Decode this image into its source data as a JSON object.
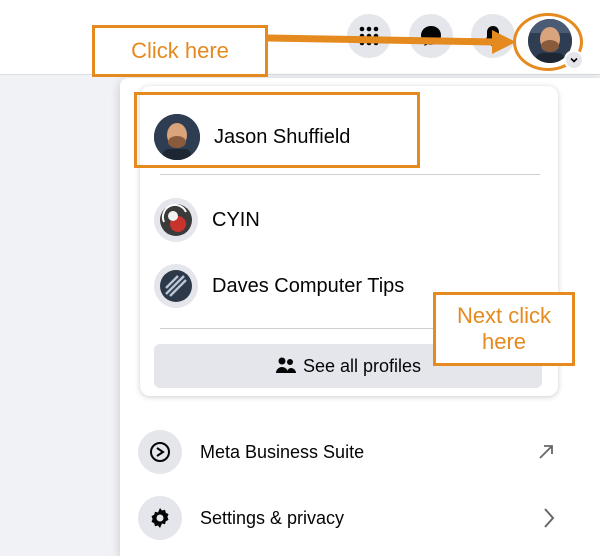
{
  "callouts": {
    "click_here": "Click here",
    "next_click": "Next click here"
  },
  "topbar": {
    "icons": [
      "menu-grid-icon",
      "messenger-icon",
      "notifications-icon"
    ],
    "account_avatar": "account-avatar"
  },
  "profiles": {
    "current": {
      "name": "Jason Shuffield"
    },
    "pages": [
      {
        "name": "CYIN"
      },
      {
        "name": "Daves Computer Tips"
      }
    ],
    "see_all_label": "See all profiles"
  },
  "menu_items": [
    {
      "label": "Meta Business Suite",
      "icon": "meta-business-suite-icon",
      "trailing": "external-link-icon"
    },
    {
      "label": "Settings & privacy",
      "icon": "gear-icon",
      "trailing": "chevron-right-icon"
    }
  ],
  "colors": {
    "accent": "#e58a1f",
    "icon_bg": "#e4e6eb",
    "page_bg": "#f0f2f5"
  }
}
